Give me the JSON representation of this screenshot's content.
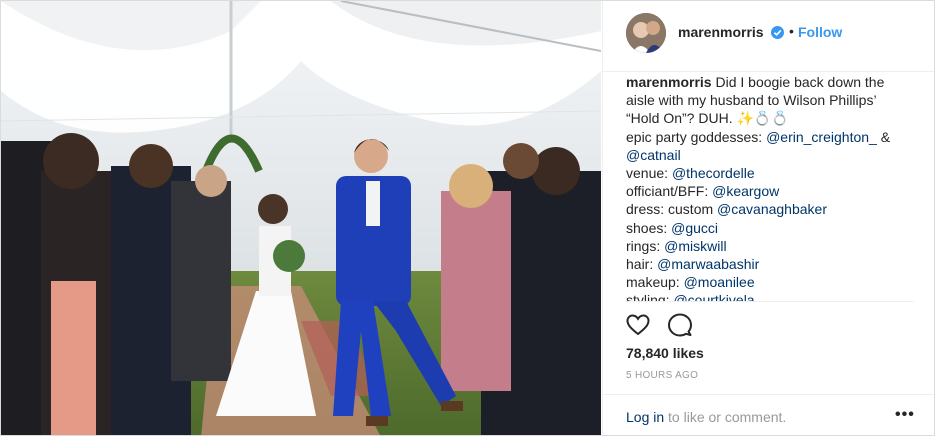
{
  "post": {
    "username": "marenmorris",
    "follow_label": "Follow",
    "separator": "•",
    "photo_description": "wedding couple walking down the aisle in a tent"
  },
  "caption": {
    "username": "marenmorris",
    "line1_text": "Did I boogie back down the",
    "line2_text": "aisle with my husband to Wilson Phillips’",
    "line3_text": "“Hold On”? DUH. ✨💍💍",
    "credits": [
      {
        "label": "epic party goddesses: ",
        "tags": [
          "@erin_creighton_",
          "@catnail"
        ],
        "joiner": " &"
      },
      {
        "label": "venue: ",
        "tags": [
          "@thecordelle"
        ]
      },
      {
        "label": "officiant/BFF: ",
        "tags": [
          "@keargow"
        ]
      },
      {
        "label": "dress: custom ",
        "tags": [
          "@cavanaghbaker"
        ]
      },
      {
        "label": "shoes: ",
        "tags": [
          "@gucci"
        ]
      },
      {
        "label": "rings: ",
        "tags": [
          "@miskwill"
        ]
      },
      {
        "label": "hair: ",
        "tags": [
          "@marwaabashir"
        ]
      },
      {
        "label": "makeup: ",
        "tags": [
          "@moanilee"
        ]
      },
      {
        "label": "styling: ",
        "tags": [
          "@courtkivela"
        ]
      }
    ]
  },
  "actions": {
    "like_icon": "heart-icon",
    "comment_icon": "comment-icon",
    "likes_text": "78,840 likes",
    "timestamp": "5 HOURS AGO"
  },
  "footer": {
    "login_link": "Log in",
    "login_rest": " to like or comment.",
    "more_icon": "more-options-icon",
    "more_glyph": "•••"
  },
  "colors": {
    "link_blue": "#3897f0",
    "tag_blue": "#003569",
    "text": "#262626",
    "muted": "#999999",
    "border": "#efefef"
  }
}
